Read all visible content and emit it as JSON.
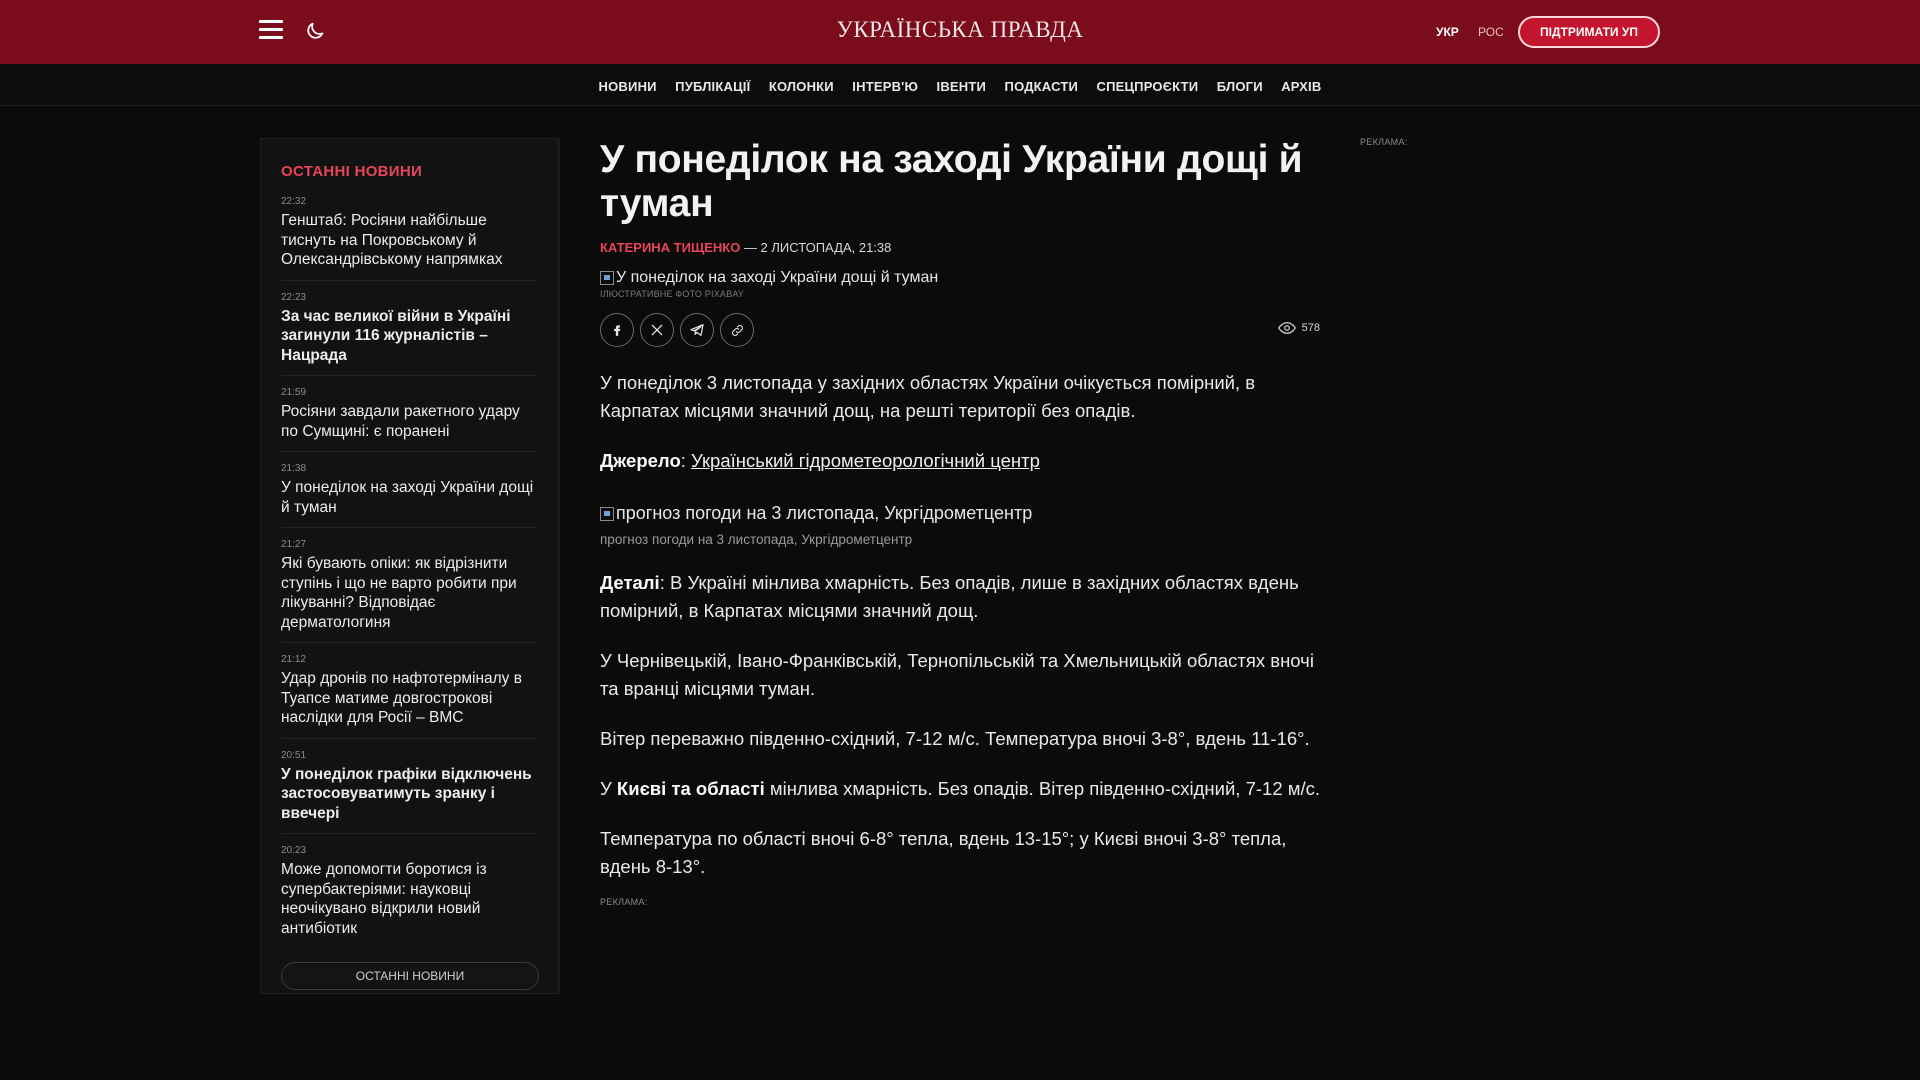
{
  "header": {
    "logo": "УКРАЇНСЬКА ПРАВДА",
    "lang_ukr": "УКР",
    "lang_ros": "РОС",
    "support": "ПІДТРИМАТИ УП",
    "menu_icon": "hamburger-menu-icon",
    "theme_icon": "moon-icon"
  },
  "nav": {
    "items": [
      "НОВИНИ",
      "ПУБЛІКАЦІЇ",
      "КОЛОНКИ",
      "ІНТЕРВ'Ю",
      "ІВЕНТИ",
      "ПОДКАСТИ",
      "СПЕЦПРОЄКТИ",
      "БЛОГИ",
      "АРХІВ"
    ]
  },
  "sidebar": {
    "title": "ОСТАННІ НОВИНИ",
    "items": [
      {
        "time": "22:32",
        "text": "Генштаб: Росіяни найбільше тиснуть на Покровському й Олександрівському напрямках",
        "bold": false
      },
      {
        "time": "22:23",
        "text": "За час великої війни в Україні загинули 116 журналістів – Нацрада",
        "bold": true
      },
      {
        "time": "21:59",
        "text": "Росіяни завдали ракетного удару по Сумщині: є поранені",
        "bold": false
      },
      {
        "time": "21:38",
        "text": "У понеділок на заході України дощі й туман",
        "bold": false
      },
      {
        "time": "21:27",
        "text": "Які бувають опіки: як відрізнити ступінь і що не варто робити при лікуванні? Відповідає дерматологиня",
        "bold": false
      },
      {
        "time": "21:12",
        "text": "Удар дронів по нафтотерміналу в Туапсе матиме довгострокові наслідки для Росії – ВМС",
        "bold": false
      },
      {
        "time": "20:51",
        "text": "У понеділок графіки відключень застосовуватимуть зранку і ввечері",
        "bold": true
      },
      {
        "time": "20:23",
        "text": "Може допомогти боротися із супербактеріями: науковці неочікувано відкрили новий антибіотик",
        "bold": false
      }
    ],
    "more": "ОСТАННІ НОВИНИ"
  },
  "article": {
    "headline": "У понеділок на заході України дощі й туман",
    "author": "КАТЕРИНА ТИЩЕНКО",
    "date": " — 2 ЛИСТОПАДА, 21:38",
    "hero_alt": "У понеділок на заході України дощі й туман",
    "hero_caption": "ІЛЮСТРАТИВНЕ ФОТО PIXABAY",
    "views": "578",
    "lead": "У понеділок 3 листопада у західних областях України очікується помірний, в Карпатах місцями значний дощ, на решті території без опадів.",
    "source_label": "Джерело",
    "source_link": "Український гідрометеорологічний центр",
    "figure_alt": "прогноз погоди на 3 листопада, Укргідрометцентр",
    "figure_caption": "прогноз погоди на 3 листопада, Укргідрометцентр",
    "details_label": "Деталі",
    "details_text": ": В Україні мінлива хмарність. Без опадів, лише в західних областях вдень помірний, в Карпатах місцями значний дощ.",
    "p2": "У Чернівецькій, Івано-Франківській, Тернопільській та Хмельницькій областях вночі та вранці місцями туман.",
    "p3": "Вітер переважно південно-східний, 7-12 м/с. Температура вночі 3-8°, вдень 11-16°.",
    "p4_pre": "У ",
    "p4_bold": "Києві та області",
    "p4_post": " мінлива хмарність. Без опадів. Вітер південно-східний, 7-12 м/с.",
    "p5": "Температура по області вночі 6-8° тепла, вдень 13-15°; у Києві вночі 3-8° тепла, вдень 8-13°."
  },
  "ads": {
    "label_right": "РЕКЛАМА:",
    "label_bottom": "РЕКЛАМА:"
  },
  "colors": {
    "brand_red": "#7b0c1b",
    "accent": "#e84558"
  }
}
